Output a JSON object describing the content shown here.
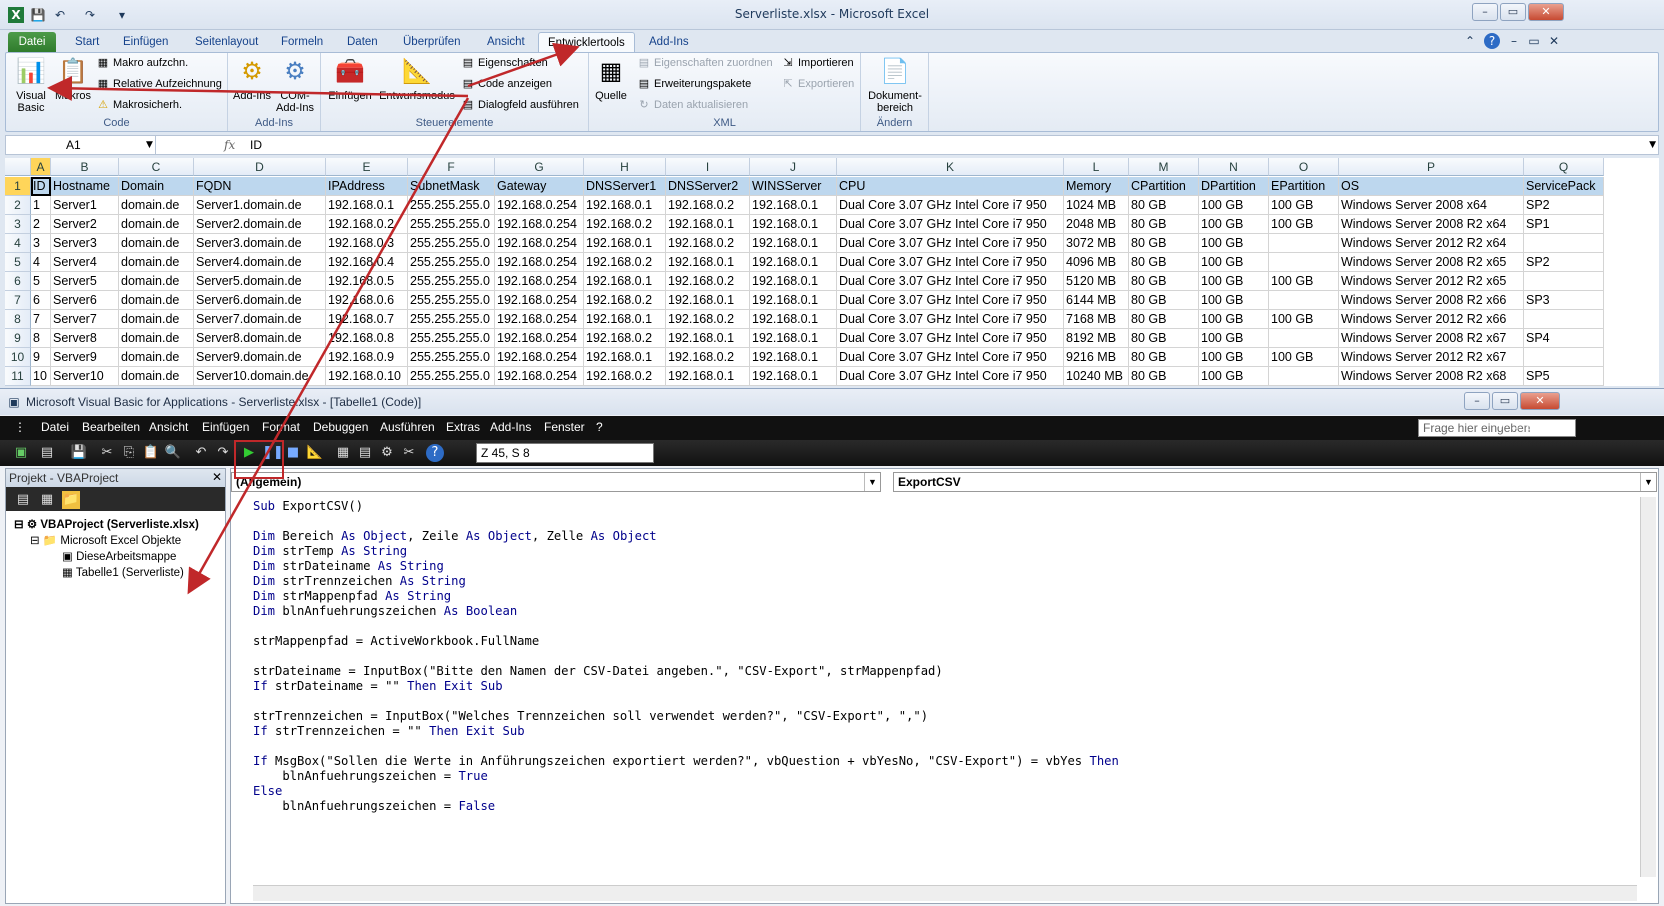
{
  "excel": {
    "title": "Serverliste.xlsx - Microsoft Excel",
    "window_controls": [
      "–",
      "▭",
      "✕"
    ],
    "tabs": [
      "Datei",
      "Start",
      "Einfügen",
      "Seitenlayout",
      "Formeln",
      "Daten",
      "Überprüfen",
      "Ansicht",
      "Entwicklertools",
      "Add-Ins"
    ],
    "active_tab": "Entwicklertools",
    "ribbon": {
      "code_group": "Code",
      "visual_basic": "Visual Basic",
      "macros": "Makros",
      "record_macro": "Makro aufzchn.",
      "relative_ref": "Relative Aufzeichnung",
      "macro_security": "Makrosicherh.",
      "addins_group": "Add-Ins",
      "addins": "Add-Ins",
      "com_addins": "COM-Add-Ins",
      "controls_group": "Steuerelemente",
      "insert": "Einfügen",
      "design_mode": "Entwurfsmodus",
      "properties": "Eigenschaften",
      "view_code": "Code anzeigen",
      "run_dialog": "Dialogfeld ausführen",
      "xml_group": "XML",
      "source": "Quelle",
      "map_properties": "Eigenschaften zuordnen",
      "expansion_packs": "Erweiterungspakete",
      "refresh_data": "Daten aktualisieren",
      "import": "Importieren",
      "export": "Exportieren",
      "modify_group": "Ändern",
      "document_panel": "Dokument-bereich"
    },
    "namebox": "A1",
    "formula": "ID",
    "columns": [
      "A",
      "B",
      "C",
      "D",
      "E",
      "F",
      "G",
      "H",
      "I",
      "J",
      "K",
      "L",
      "M",
      "N",
      "O",
      "P",
      "Q"
    ],
    "rows": [
      [
        "ID",
        "Hostname",
        "Domain",
        "FQDN",
        "IPAddress",
        "SubnetMask",
        "Gateway",
        "DNSServer1",
        "DNSServer2",
        "WINSServer",
        "CPU",
        "Memory",
        "CPartition",
        "DPartition",
        "EPartition",
        "OS",
        "ServicePack"
      ],
      [
        "1",
        "Server1",
        "domain.de",
        "Server1.domain.de",
        "192.168.0.1",
        "255.255.255.0",
        "192.168.0.254",
        "192.168.0.1",
        "192.168.0.2",
        "192.168.0.1",
        "Dual Core 3.07 GHz Intel Core i7 950",
        "1024 MB",
        "80 GB",
        "100 GB",
        "100 GB",
        "Windows Server 2008 x64",
        "SP2"
      ],
      [
        "2",
        "Server2",
        "domain.de",
        "Server2.domain.de",
        "192.168.0.2",
        "255.255.255.0",
        "192.168.0.254",
        "192.168.0.2",
        "192.168.0.1",
        "192.168.0.1",
        "Dual Core 3.07 GHz Intel Core i7 950",
        "2048 MB",
        "80 GB",
        "100 GB",
        "100 GB",
        "Windows Server 2008 R2 x64",
        "SP1"
      ],
      [
        "3",
        "Server3",
        "domain.de",
        "Server3.domain.de",
        "192.168.0.3",
        "255.255.255.0",
        "192.168.0.254",
        "192.168.0.1",
        "192.168.0.2",
        "192.168.0.1",
        "Dual Core 3.07 GHz Intel Core i7 950",
        "3072 MB",
        "80 GB",
        "100 GB",
        "",
        "Windows Server 2012 R2 x64",
        ""
      ],
      [
        "4",
        "Server4",
        "domain.de",
        "Server4.domain.de",
        "192.168.0.4",
        "255.255.255.0",
        "192.168.0.254",
        "192.168.0.2",
        "192.168.0.1",
        "192.168.0.1",
        "Dual Core 3.07 GHz Intel Core i7 950",
        "4096 MB",
        "80 GB",
        "100 GB",
        "",
        "Windows Server 2008 R2 x65",
        "SP2"
      ],
      [
        "5",
        "Server5",
        "domain.de",
        "Server5.domain.de",
        "192.168.0.5",
        "255.255.255.0",
        "192.168.0.254",
        "192.168.0.1",
        "192.168.0.2",
        "192.168.0.1",
        "Dual Core 3.07 GHz Intel Core i7 950",
        "5120 MB",
        "80 GB",
        "100 GB",
        "100 GB",
        "Windows Server 2012 R2 x65",
        ""
      ],
      [
        "6",
        "Server6",
        "domain.de",
        "Server6.domain.de",
        "192.168.0.6",
        "255.255.255.0",
        "192.168.0.254",
        "192.168.0.2",
        "192.168.0.1",
        "192.168.0.1",
        "Dual Core 3.07 GHz Intel Core i7 950",
        "6144 MB",
        "80 GB",
        "100 GB",
        "",
        "Windows Server 2008 R2 x66",
        "SP3"
      ],
      [
        "7",
        "Server7",
        "domain.de",
        "Server7.domain.de",
        "192.168.0.7",
        "255.255.255.0",
        "192.168.0.254",
        "192.168.0.1",
        "192.168.0.2",
        "192.168.0.1",
        "Dual Core 3.07 GHz Intel Core i7 950",
        "7168 MB",
        "80 GB",
        "100 GB",
        "100 GB",
        "Windows Server 2012 R2 x66",
        ""
      ],
      [
        "8",
        "Server8",
        "domain.de",
        "Server8.domain.de",
        "192.168.0.8",
        "255.255.255.0",
        "192.168.0.254",
        "192.168.0.2",
        "192.168.0.1",
        "192.168.0.1",
        "Dual Core 3.07 GHz Intel Core i7 950",
        "8192 MB",
        "80 GB",
        "100 GB",
        "",
        "Windows Server 2008 R2 x67",
        "SP4"
      ],
      [
        "9",
        "Server9",
        "domain.de",
        "Server9.domain.de",
        "192.168.0.9",
        "255.255.255.0",
        "192.168.0.254",
        "192.168.0.1",
        "192.168.0.2",
        "192.168.0.1",
        "Dual Core 3.07 GHz Intel Core i7 950",
        "9216 MB",
        "80 GB",
        "100 GB",
        "100 GB",
        "Windows Server 2012 R2 x67",
        ""
      ],
      [
        "10",
        "Server10",
        "domain.de",
        "Server10.domain.de",
        "192.168.0.10",
        "255.255.255.0",
        "192.168.0.254",
        "192.168.0.2",
        "192.168.0.1",
        "192.168.0.1",
        "Dual Core 3.07 GHz Intel Core i7 950",
        "10240 MB",
        "80 GB",
        "100 GB",
        "",
        "Windows Server 2008 R2 x68",
        "SP5"
      ]
    ]
  },
  "vba": {
    "title": "Microsoft Visual Basic for Applications - Serverliste.xlsx - [Tabelle1 (Code)]",
    "menu": [
      "Datei",
      "Bearbeiten",
      "Ansicht",
      "Einfügen",
      "Format",
      "Debuggen",
      "Ausführen",
      "Extras",
      "Add-Ins",
      "Fenster",
      "?"
    ],
    "help_placeholder": "Frage hier eingeben",
    "position": "Z 45, S 8",
    "project_title": "Projekt - VBAProject",
    "tree": {
      "root": "VBAProject (Serverliste.xlsx)",
      "folder": "Microsoft Excel Objekte",
      "item1": "DieseArbeitsmappe",
      "item2": "Tabelle1 (Serverliste)"
    },
    "object_combo": "(Allgemein)",
    "proc_combo": "ExportCSV",
    "code": [
      "Sub ExportCSV()",
      "",
      "Dim Bereich As Object, Zeile As Object, Zelle As Object",
      "Dim strTemp As String",
      "Dim strDateiname As String",
      "Dim strTrennzeichen As String",
      "Dim strMappenpfad As String",
      "Dim blnAnfuehrungszeichen As Boolean",
      "",
      "strMappenpfad = ActiveWorkbook.FullName",
      "",
      "strDateiname = InputBox(\"Bitte den Namen der CSV-Datei angeben.\", \"CSV-Export\", strMappenpfad)",
      "If strDateiname = \"\" Then Exit Sub",
      "",
      "strTrennzeichen = InputBox(\"Welches Trennzeichen soll verwendet werden?\", \"CSV-Export\", \",\")",
      "If strTrennzeichen = \"\" Then Exit Sub",
      "",
      "If MsgBox(\"Sollen die Werte in Anführungszeichen exportiert werden?\", vbQuestion + vbYesNo, \"CSV-Export\") = vbYes Then",
      "    blnAnfuehrungszeichen = True",
      "Else",
      "    blnAnfuehrungszeichen = False"
    ]
  },
  "colors": {
    "header_fill": "#bdd7ee",
    "selected_header": "#ffd55a",
    "arrow": "#c0282a",
    "keyword": "#00008b"
  }
}
